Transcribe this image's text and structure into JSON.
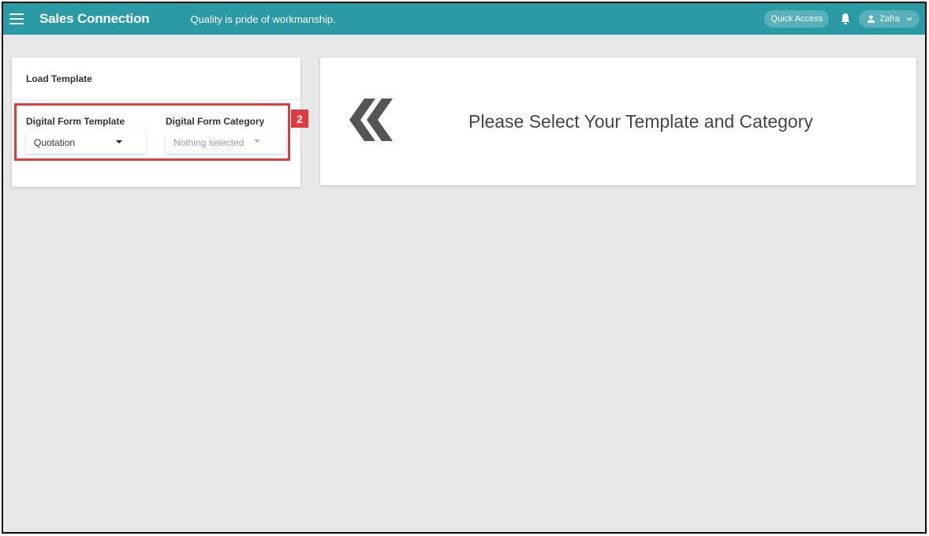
{
  "topbar": {
    "app_title": "Sales Connection",
    "tagline": "Quality is pride of workmanship.",
    "quick_access_label": "Quick Access",
    "user_name": "Zafra",
    "bar_color": "#2a9aa4"
  },
  "load_template": {
    "title": "Load Template",
    "template_field": {
      "label": "Digital Form Template",
      "selected": "Quotation"
    },
    "category_field": {
      "label": "Digital Form Category",
      "placeholder": "Nothing selected"
    }
  },
  "annotation": {
    "badge": "2",
    "color": "#e23b3b"
  },
  "main": {
    "prompt": "Please Select Your Template and Category"
  }
}
